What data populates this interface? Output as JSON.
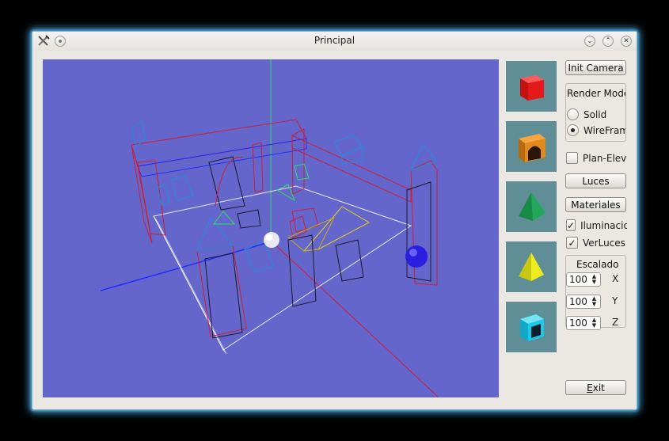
{
  "window": {
    "title": "Principal"
  },
  "titlebar": {
    "minimize_symbol": "⌄",
    "maximize_symbol": "⌃",
    "close_symbol": "✕"
  },
  "thumbnails": [
    {
      "name": "red-cube",
      "color": "#e41a1a"
    },
    {
      "name": "orange-arch",
      "color": "#e2891d"
    },
    {
      "name": "green-tetrahedron",
      "color": "#22a85a"
    },
    {
      "name": "yellow-pyramid",
      "color": "#ecec1e"
    },
    {
      "name": "cyan-hollow-cube",
      "color": "#1ec8e8"
    }
  ],
  "controls": {
    "init_camera": "Init Camera",
    "render_mode": {
      "title": "Render Mode",
      "options": [
        {
          "label": "Solid",
          "selected": false
        },
        {
          "label": "WireFrame",
          "selected": true
        }
      ]
    },
    "plan_elev": {
      "label": "Plan-Elev",
      "checked": false
    },
    "luces": "Luces",
    "materiales": "Materiales",
    "iluminacion": {
      "label": "Iluminacion",
      "checked": true
    },
    "ver_luces": {
      "label": "VerLuces",
      "checked": true
    },
    "escalado": {
      "title": "Escalado",
      "x": {
        "value": "100",
        "axis": "X"
      },
      "y": {
        "value": "100",
        "axis": "Y"
      },
      "z": {
        "value": "100",
        "axis": "Z"
      }
    },
    "exit_prefix": "E",
    "exit_rest": "xit"
  },
  "scene": {
    "background": "#6566cc"
  }
}
